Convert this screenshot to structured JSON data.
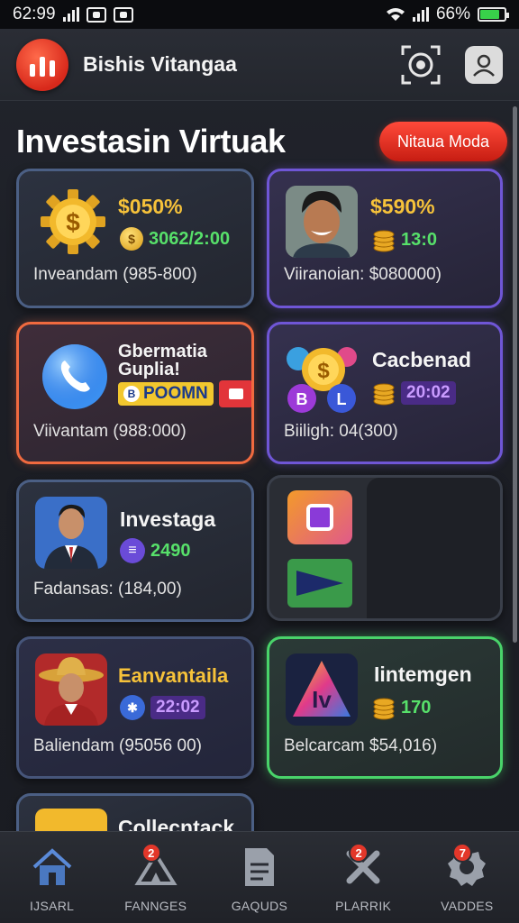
{
  "status_bar": {
    "time": "62:99",
    "battery_percent": "66%"
  },
  "header": {
    "app_name": "Bishis Vitangaa"
  },
  "page": {
    "title": "Investasin Virtuak",
    "new_button": "Nitaua Moda"
  },
  "cards": [
    {
      "value": "$050%",
      "sub": "3062/2:00",
      "footer": "Inveandam (985-800)",
      "colors": {
        "sub": "#57e06a"
      }
    },
    {
      "value": "$590%",
      "sub": "13:0",
      "footer": "Viiranoian: $080000)",
      "colors": {
        "sub": "#57e06a"
      }
    },
    {
      "title": "Gbermatia Guplia!",
      "badge": "POOMN",
      "footer": "Viivantam (988:000)"
    },
    {
      "title": "Cacbenad",
      "sub": "20:02",
      "footer": "Biiligh: 04(300)",
      "colors": {
        "sub": "#c99bff"
      }
    },
    {
      "title": "Investaga",
      "sub": "2490",
      "footer": "Fadansas: (184,00)",
      "colors": {
        "sub": "#57e06a"
      }
    },
    {
      "title": "Eanvantaila",
      "sub": "22:02",
      "footer": "Baliendam (95056 00)",
      "colors": {
        "sub": "#c99bff",
        "title": "#f6c23a"
      }
    },
    {
      "title": "Iintemgen",
      "sub": "170",
      "footer": "Belcarcam $54,016)",
      "colors": {
        "sub": "#57e06a"
      }
    },
    {
      "title": "Collecntack"
    }
  ],
  "bottom_nav": [
    {
      "label": "IJSARL",
      "icon": "home-icon"
    },
    {
      "label": "FANNGES",
      "icon": "tent-icon",
      "badge": "2"
    },
    {
      "label": "GAQUDS",
      "icon": "document-icon"
    },
    {
      "label": "PLARRIK",
      "icon": "tools-icon",
      "badge": "2"
    },
    {
      "label": "VADDES",
      "icon": "settings-icon",
      "badge": "7"
    }
  ]
}
